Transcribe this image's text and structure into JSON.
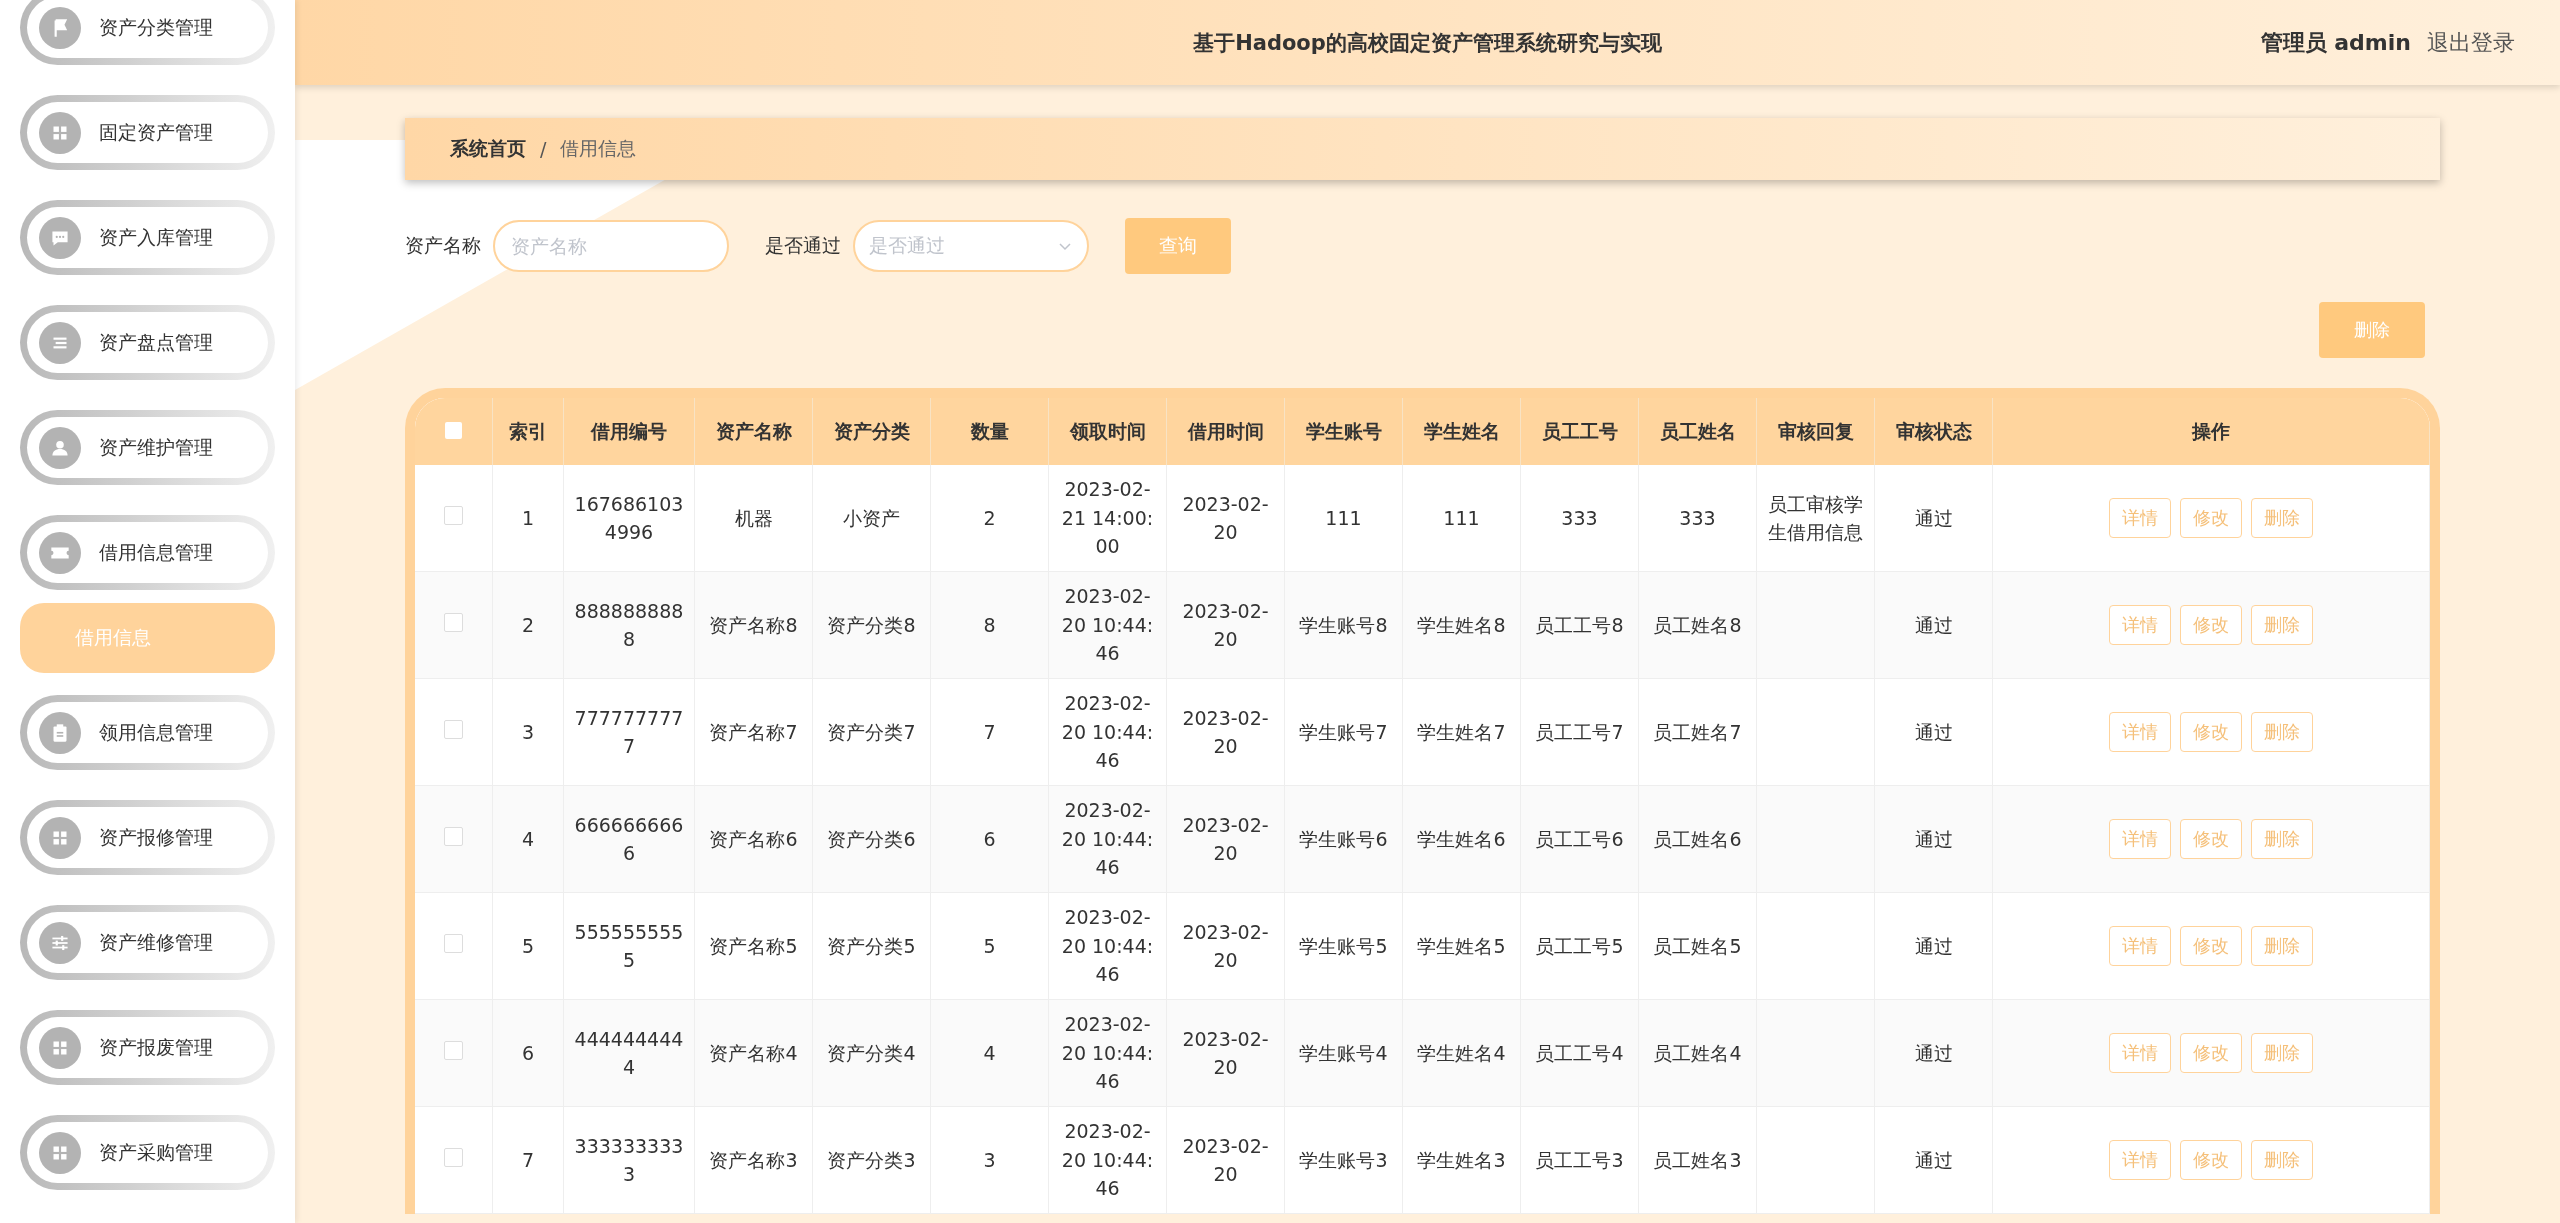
{
  "header": {
    "title": "基于Hadoop的高校固定资产管理系统研究与实现",
    "user": "管理员 admin",
    "logout": "退出登录"
  },
  "sidebar": {
    "items": [
      {
        "label": "资产分类管理",
        "kind": "flag"
      },
      {
        "label": "固定资产管理",
        "kind": "grid"
      },
      {
        "label": "资产入库管理",
        "kind": "chat"
      },
      {
        "label": "资产盘点管理",
        "kind": "list"
      },
      {
        "label": "资产维护管理",
        "kind": "person"
      },
      {
        "label": "借用信息管理",
        "kind": "ticket",
        "children": [
          {
            "label": "借用信息",
            "selected": true
          }
        ]
      },
      {
        "label": "领用信息管理",
        "kind": "clipboard"
      },
      {
        "label": "资产报修管理",
        "kind": "grid"
      },
      {
        "label": "资产维修管理",
        "kind": "sliders"
      },
      {
        "label": "资产报废管理",
        "kind": "grid"
      },
      {
        "label": "资产采购管理",
        "kind": "grid"
      }
    ]
  },
  "breadcrumb": [
    "系统首页",
    "/",
    "借用信息"
  ],
  "search": {
    "fields": [
      {
        "label": "资产名称",
        "kind": "input",
        "placeholder": "资产名称"
      },
      {
        "label": "是否通过",
        "kind": "select",
        "placeholder": "是否通过"
      }
    ],
    "button": "查询"
  },
  "delete_button": "删除",
  "table": {
    "columns": [
      "索引",
      "借用编号",
      "资产名称",
      "资产分类",
      "数量",
      "领取时间",
      "借用时间",
      "学生账号",
      "学生姓名",
      "员工工号",
      "员工姓名",
      "审核回复",
      "审核状态",
      "操作"
    ],
    "select_all": {
      "checked": false
    },
    "rows": [
      {
        "checked": false,
        "actions": [
          "详情",
          "修改",
          "删除"
        ],
        "cells": [
          "1",
          "1676861034996",
          "机器",
          "小资产",
          "2",
          "2023-02-21 14:00:00",
          "2023-02-20",
          "111",
          "111",
          "333",
          "333",
          "员工审核学生借用信息",
          "通过"
        ]
      },
      {
        "checked": false,
        "actions": [
          "详情",
          "修改",
          "删除"
        ],
        "cells": [
          "2",
          "8888888888",
          "资产名称8",
          "资产分类8",
          "8",
          "2023-02-20 10:44:46",
          "2023-02-20",
          "学生账号8",
          "学生姓名8",
          "员工工号8",
          "员工姓名8",
          "",
          "通过"
        ]
      },
      {
        "checked": false,
        "actions": [
          "详情",
          "修改",
          "删除"
        ],
        "cells": [
          "3",
          "7777777777",
          "资产名称7",
          "资产分类7",
          "7",
          "2023-02-20 10:44:46",
          "2023-02-20",
          "学生账号7",
          "学生姓名7",
          "员工工号7",
          "员工姓名7",
          "",
          "通过"
        ]
      },
      {
        "checked": false,
        "actions": [
          "详情",
          "修改",
          "删除"
        ],
        "cells": [
          "4",
          "6666666666",
          "资产名称6",
          "资产分类6",
          "6",
          "2023-02-20 10:44:46",
          "2023-02-20",
          "学生账号6",
          "学生姓名6",
          "员工工号6",
          "员工姓名6",
          "",
          "通过"
        ]
      },
      {
        "checked": false,
        "actions": [
          "详情",
          "修改",
          "删除"
        ],
        "cells": [
          "5",
          "5555555555",
          "资产名称5",
          "资产分类5",
          "5",
          "2023-02-20 10:44:46",
          "2023-02-20",
          "学生账号5",
          "学生姓名5",
          "员工工号5",
          "员工姓名5",
          "",
          "通过"
        ]
      },
      {
        "checked": false,
        "actions": [
          "详情",
          "修改",
          "删除"
        ],
        "cells": [
          "6",
          "4444444444",
          "资产名称4",
          "资产分类4",
          "4",
          "2023-02-20 10:44:46",
          "2023-02-20",
          "学生账号4",
          "学生姓名4",
          "员工工号4",
          "员工姓名4",
          "",
          "通过"
        ]
      },
      {
        "checked": false,
        "actions": [
          "详情",
          "修改",
          "删除"
        ],
        "cells": [
          "7",
          "3333333333",
          "资产名称3",
          "资产分类3",
          "3",
          "2023-02-20 10:44:46",
          "2023-02-20",
          "学生账号3",
          "学生姓名3",
          "员工工号3",
          "员工姓名3",
          "",
          "通过"
        ]
      }
    ]
  }
}
